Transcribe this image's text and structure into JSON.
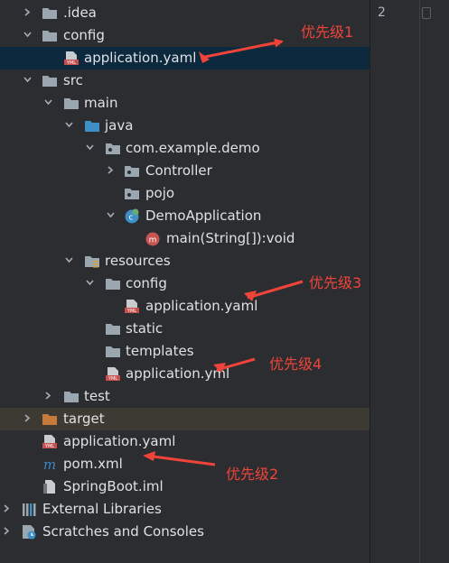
{
  "editor": {
    "line_number": "2"
  },
  "tree": [
    {
      "label": ".idea",
      "expanded": false,
      "icon": "folder-icon"
    },
    {
      "label": "config",
      "expanded": true,
      "icon": "folder-icon"
    },
    {
      "label": "application.yaml",
      "icon": "yaml-file-icon",
      "selected": true
    },
    {
      "label": "src",
      "expanded": true,
      "icon": "folder-icon"
    },
    {
      "label": "main",
      "expanded": true,
      "icon": "folder-icon"
    },
    {
      "label": "java",
      "expanded": true,
      "icon": "source-folder-icon"
    },
    {
      "label": "com.example.demo",
      "expanded": true,
      "icon": "package-icon"
    },
    {
      "label": "Controller",
      "expanded": false,
      "icon": "package-icon"
    },
    {
      "label": "pojo",
      "icon": "package-icon"
    },
    {
      "label": "DemoApplication",
      "expanded": true,
      "icon": "spring-class-icon"
    },
    {
      "label": "main(String[]):void",
      "icon": "method-icon"
    },
    {
      "label": "resources",
      "expanded": true,
      "icon": "resources-folder-icon"
    },
    {
      "label": "config",
      "expanded": true,
      "icon": "folder-icon"
    },
    {
      "label": "application.yaml",
      "icon": "yaml-file-icon"
    },
    {
      "label": "static",
      "icon": "folder-icon"
    },
    {
      "label": "templates",
      "icon": "folder-icon"
    },
    {
      "label": "application.yml",
      "icon": "yaml-file-icon"
    },
    {
      "label": "test",
      "expanded": false,
      "icon": "folder-icon"
    },
    {
      "label": "target",
      "expanded": false,
      "icon": "excluded-folder-icon"
    },
    {
      "label": "application.yaml",
      "icon": "yaml-file-icon"
    },
    {
      "label": "pom.xml",
      "icon": "maven-icon"
    },
    {
      "label": "SpringBoot.iml",
      "icon": "iml-file-icon"
    },
    {
      "label": "External Libraries",
      "expanded": false,
      "icon": "libraries-icon"
    },
    {
      "label": "Scratches and Consoles",
      "expanded": false,
      "icon": "scratches-icon"
    }
  ],
  "annotations": [
    {
      "text": "优先级1"
    },
    {
      "text": "优先级3"
    },
    {
      "text": "优先级4"
    },
    {
      "text": "优先级2"
    }
  ],
  "colors": {
    "annotation": "#f0443a",
    "folder": "#9aa7b0",
    "source_folder": "#3d8fc6",
    "excluded_folder": "#c67b3d",
    "yaml": "#c94f4f",
    "maven": "#3e86c9",
    "selected_row": "#0d293e",
    "target_row": "#3d3a33"
  }
}
